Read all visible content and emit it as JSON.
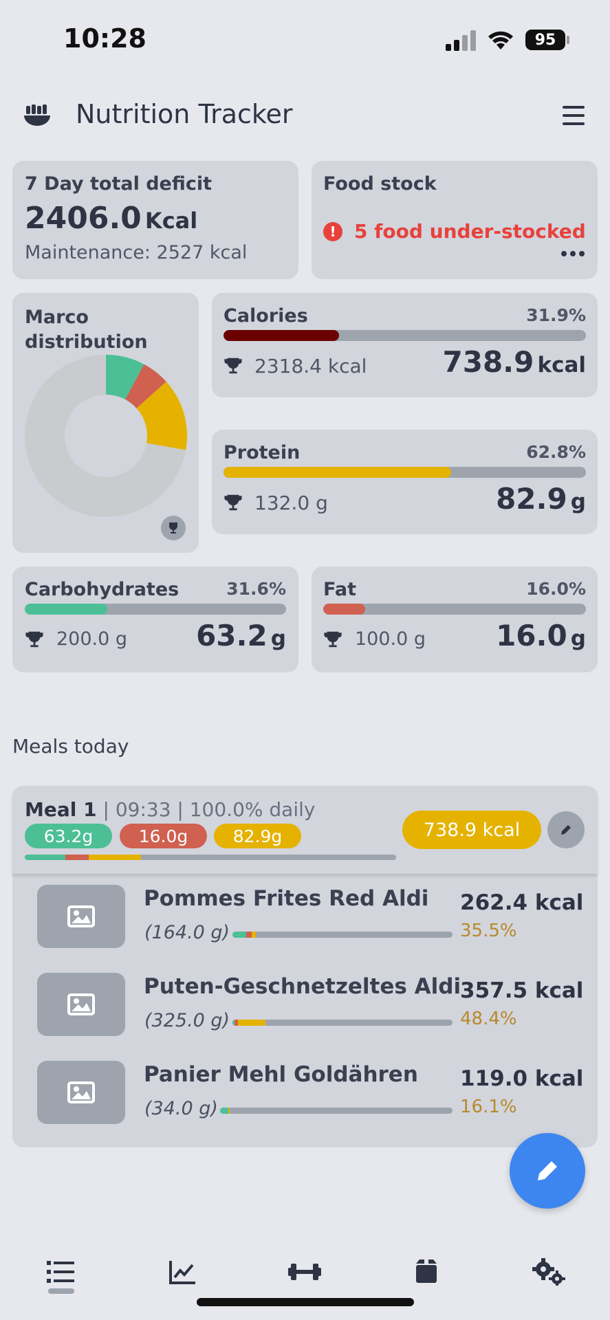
{
  "status_bar": {
    "time": "10:28",
    "battery": "95"
  },
  "header": {
    "title": "Nutrition Tracker",
    "logo_icon": "bowl-icon",
    "menu_icon": "hamburger-menu-icon"
  },
  "deficit": {
    "title": "7 Day total deficit",
    "value": "2406.0",
    "unit": "Kcal",
    "maintenance": "Maintenance: 2527 kcal"
  },
  "food_stock": {
    "title": "Food stock",
    "alert": "5 food under-stocked",
    "alert_color": "#e8413c"
  },
  "macro": {
    "title": "Marco distribution",
    "slices": [
      {
        "name": "Carbohydrates",
        "value": 31.6,
        "color": "#4cbf96"
      },
      {
        "name": "Fat",
        "value": 16.0,
        "color": "#d0604f"
      },
      {
        "name": "Protein",
        "value": 62.8,
        "color": "#e5b200"
      }
    ]
  },
  "calories": {
    "title": "Calories",
    "pct": "31.9%",
    "fill": 0.319,
    "color": "#6b0000",
    "goal": "2318.4",
    "goal_unit": "kcal",
    "value": "738.9",
    "unit": "kcal"
  },
  "protein": {
    "title": "Protein",
    "pct": "62.8%",
    "fill": 0.628,
    "color": "#e5b200",
    "goal": "132.0",
    "goal_unit": "g",
    "value": "82.9",
    "unit": "g"
  },
  "carbs": {
    "title": "Carbohydrates",
    "pct": "31.6%",
    "fill": 0.316,
    "color": "#4cbf96",
    "goal": "200.0",
    "goal_unit": "g",
    "value": "63.2",
    "unit": "g"
  },
  "fat": {
    "title": "Fat",
    "pct": "16.0%",
    "fill": 0.16,
    "color": "#d0604f",
    "goal": "100.0",
    "goal_unit": "g",
    "value": "16.0",
    "unit": "g"
  },
  "meals_heading": "Meals today",
  "meal": {
    "name": "Meal 1",
    "meta": "| 09:33 | 100.0% daily",
    "carbs": "63.2g",
    "fat": "16.0g",
    "protein": "82.9g",
    "kcal": "738.9 kcal",
    "items": [
      {
        "name": "Pommes Frites Red Aldi",
        "weight": "(164.0 g)",
        "kcal": "262.4 kcal",
        "pct": "35.5%"
      },
      {
        "name": "Puten-Geschnetzeltes Aldi",
        "weight": "(325.0 g)",
        "kcal": "357.5 kcal",
        "pct": "48.4%"
      },
      {
        "name": "Panier Mehl Goldähren",
        "weight": "(34.0 g)",
        "kcal": "119.0 kcal",
        "pct": "16.1%"
      }
    ]
  },
  "nav": [
    "list-icon",
    "chart-icon",
    "dumbbell-icon",
    "box-icon",
    "gears-icon"
  ]
}
